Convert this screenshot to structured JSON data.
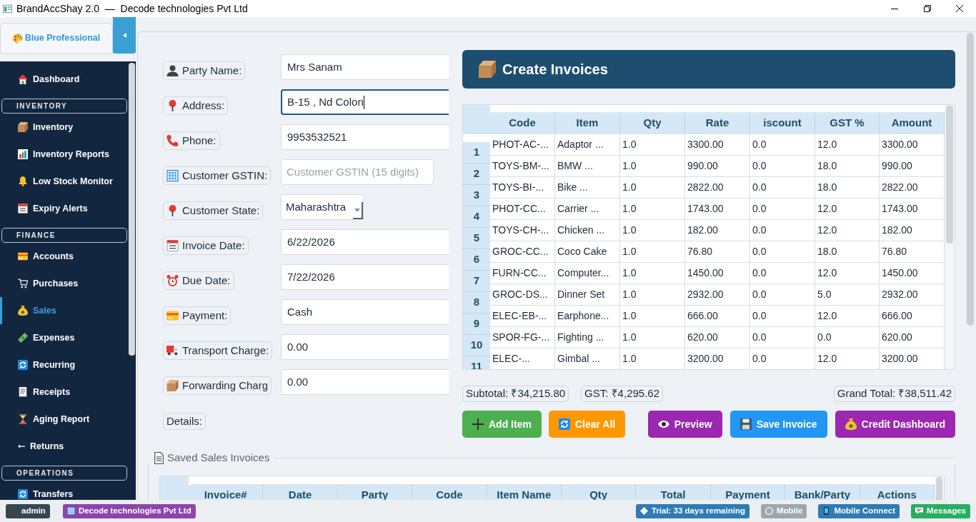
{
  "window": {
    "title": "BrandAccShay 2.0  —  Decode technologies Pvt Ltd"
  },
  "sidebar": {
    "theme": {
      "label": "Blue Professional"
    },
    "items": [
      {
        "kind": "link",
        "label": "Dashboard",
        "selected": false
      },
      {
        "kind": "section",
        "label": "INVENTORY"
      },
      {
        "kind": "link",
        "label": "Inventory",
        "selected": false
      },
      {
        "kind": "link",
        "label": "Inventory Reports",
        "selected": false
      },
      {
        "kind": "link",
        "label": "Low Stock Monitor",
        "selected": false
      },
      {
        "kind": "link",
        "label": "Expiry Alerts",
        "selected": false
      },
      {
        "kind": "section",
        "label": "FINANCE"
      },
      {
        "kind": "link",
        "label": "Accounts",
        "selected": false
      },
      {
        "kind": "link",
        "label": "Purchases",
        "selected": false
      },
      {
        "kind": "link",
        "label": "Sales",
        "selected": true
      },
      {
        "kind": "link",
        "label": "Expenses",
        "selected": false
      },
      {
        "kind": "link",
        "label": "Recurring",
        "selected": false
      },
      {
        "kind": "link",
        "label": "Receipts",
        "selected": false
      },
      {
        "kind": "link",
        "label": "Aging Report",
        "selected": false
      },
      {
        "kind": "link",
        "label": "Returns",
        "selected": false
      },
      {
        "kind": "section",
        "label": "OPERATIONS"
      },
      {
        "kind": "link",
        "label": "Transfers",
        "selected": false
      }
    ]
  },
  "form": {
    "fields": [
      {
        "kind": "text",
        "label": "Party Name:",
        "value": "Mrs Sanam",
        "focused": false
      },
      {
        "kind": "text",
        "label": "Address:",
        "value": "B-15 , Nd Colon",
        "focused": true
      },
      {
        "kind": "text",
        "label": "Phone:",
        "value": "9953532521",
        "focused": false
      },
      {
        "kind": "short_text",
        "label": "Customer GSTIN:",
        "placeholder": "Customer GSTIN (15 digits)",
        "focused": false
      },
      {
        "kind": "dropdown",
        "label": "Customer State:",
        "value": "Maharashtra",
        "focused": false
      },
      {
        "kind": "text",
        "label": "Invoice Date:",
        "value": "6/22/2026",
        "focused": false
      },
      {
        "kind": "text",
        "label": "Due Date:",
        "value": "7/22/2026",
        "focused": false
      },
      {
        "kind": "text",
        "label": "Payment:",
        "value": "Cash",
        "focused": false
      },
      {
        "kind": "text",
        "label": "Transport Charge:",
        "value": "0.00",
        "focused": false
      },
      {
        "kind": "text",
        "label": "Forwarding Charg",
        "value": "0.00",
        "focused": false
      },
      {
        "kind": "label",
        "label": "Details:"
      }
    ]
  },
  "invoice": {
    "title": "Create Invoices",
    "table": {
      "columns": [
        "Code",
        "Item",
        "Qty",
        "Rate",
        "iscount",
        "GST %",
        "Amount"
      ],
      "rows": [
        {
          "number": "1",
          "cells": [
            "PHOT-AC-...",
            "Adaptor ...",
            "1.0",
            "3300.00",
            "0.0",
            "12.0",
            "3300.00"
          ]
        },
        {
          "number": "2",
          "cells": [
            "TOYS-BM-...",
            "BMW ...",
            "1.0",
            "990.00",
            "0.0",
            "18.0",
            "990.00"
          ]
        },
        {
          "number": "3",
          "cells": [
            "TOYS-BI-...",
            "Bike ...",
            "1.0",
            "2822.00",
            "0.0",
            "18.0",
            "2822.00"
          ]
        },
        {
          "number": "4",
          "cells": [
            "PHOT-CC...",
            "Carrier ...",
            "1.0",
            "1743.00",
            "0.0",
            "12.0",
            "1743.00"
          ]
        },
        {
          "number": "5",
          "cells": [
            "TOYS-CH-...",
            "Chicken ...",
            "1.0",
            "182.00",
            "0.0",
            "12.0",
            "182.00"
          ]
        },
        {
          "number": "6",
          "cells": [
            "GROC-CC...",
            "Coco Cake",
            "1.0",
            "76.80",
            "0.0",
            "18.0",
            "76.80"
          ]
        },
        {
          "number": "7",
          "cells": [
            "FURN-CC...",
            "Computer...",
            "1.0",
            "1450.00",
            "0.0",
            "12.0",
            "1450.00"
          ]
        },
        {
          "number": "8",
          "cells": [
            "GROC-DS...",
            "Dinner Set",
            "1.0",
            "2932.00",
            "0.0",
            "5.0",
            "2932.00"
          ]
        },
        {
          "number": "9",
          "cells": [
            "ELEC-EB-...",
            "Earphone...",
            "1.0",
            "666.00",
            "0.0",
            "12.0",
            "666.00"
          ]
        },
        {
          "number": "10",
          "cells": [
            "SPOR-FG-...",
            "Fighting ...",
            "1.0",
            "620.00",
            "0.0",
            "0.0",
            "620.00"
          ]
        },
        {
          "number": "11",
          "cells": [
            "ELEC-...",
            "Gimbal ...",
            "1.0",
            "3200.00",
            "0.0",
            "12.0",
            "3200.00"
          ]
        }
      ]
    },
    "totals": [
      "Subtotal: ₹34,215.80",
      "GST: ₹4,295.62",
      "Grand Total: ₹38,511.42"
    ],
    "actions": [
      {
        "label": "Add Item",
        "color": "#4caf50"
      },
      {
        "label": "Clear All",
        "color": "#ff9800"
      },
      {
        "label": "Preview",
        "color": "#9c27b0"
      },
      {
        "label": "Save Invoice",
        "color": "#2196f3"
      },
      {
        "label": "Credit Dashboard",
        "color": "#9c27b0"
      }
    ]
  },
  "saved_invoices": {
    "title": "Saved Sales Invoices",
    "columns": [
      "Invoice#",
      "Date",
      "Party",
      "Code",
      "Item Name",
      "Qty",
      "Total",
      "Payment",
      "Bank/Party",
      "Actions"
    ]
  },
  "status_bar": {
    "left": [
      {
        "label": "admin",
        "color": "#37474f"
      },
      {
        "label": "Decode technologies Pvt Ltd",
        "color": "#8e44ad"
      }
    ],
    "right": [
      {
        "label": "Trial: 33 days remaining",
        "color": "#2e7bb6"
      },
      {
        "label": "Mobile",
        "color": "#9ea7ad"
      },
      {
        "label": "Mobile Connect",
        "color": "#2e7bb6"
      },
      {
        "label": "Messages",
        "color": "#27ae60"
      }
    ]
  }
}
